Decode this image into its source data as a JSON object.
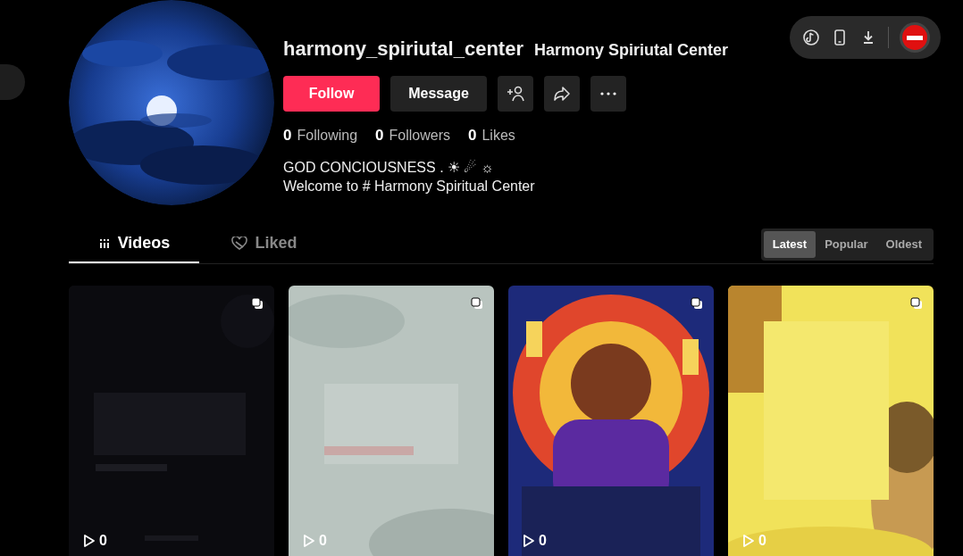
{
  "profile": {
    "username": "harmony_spiriutal_center",
    "nickname": "Harmony Spiriutal Center",
    "follow_label": "Follow",
    "message_label": "Message",
    "stats": [
      {
        "count": "0",
        "label": "Following"
      },
      {
        "count": "0",
        "label": "Followers"
      },
      {
        "count": "0",
        "label": "Likes"
      }
    ],
    "bio": [
      "GOD CONCIOUSNESS . ☀ ☄ ☼",
      "Welcome to # Harmony Spiritual Center"
    ]
  },
  "tabs": [
    {
      "label": "Videos",
      "selected": true
    },
    {
      "label": "Liked",
      "selected": false
    }
  ],
  "sort_options": [
    {
      "label": "Latest",
      "selected": true
    },
    {
      "label": "Popular",
      "selected": false
    },
    {
      "label": "Oldest",
      "selected": false
    }
  ],
  "videos": [
    {
      "views": "0",
      "kind": "picture"
    },
    {
      "views": "0",
      "kind": "picture"
    },
    {
      "views": "0",
      "kind": "picture"
    },
    {
      "views": "0",
      "kind": "picture"
    }
  ]
}
